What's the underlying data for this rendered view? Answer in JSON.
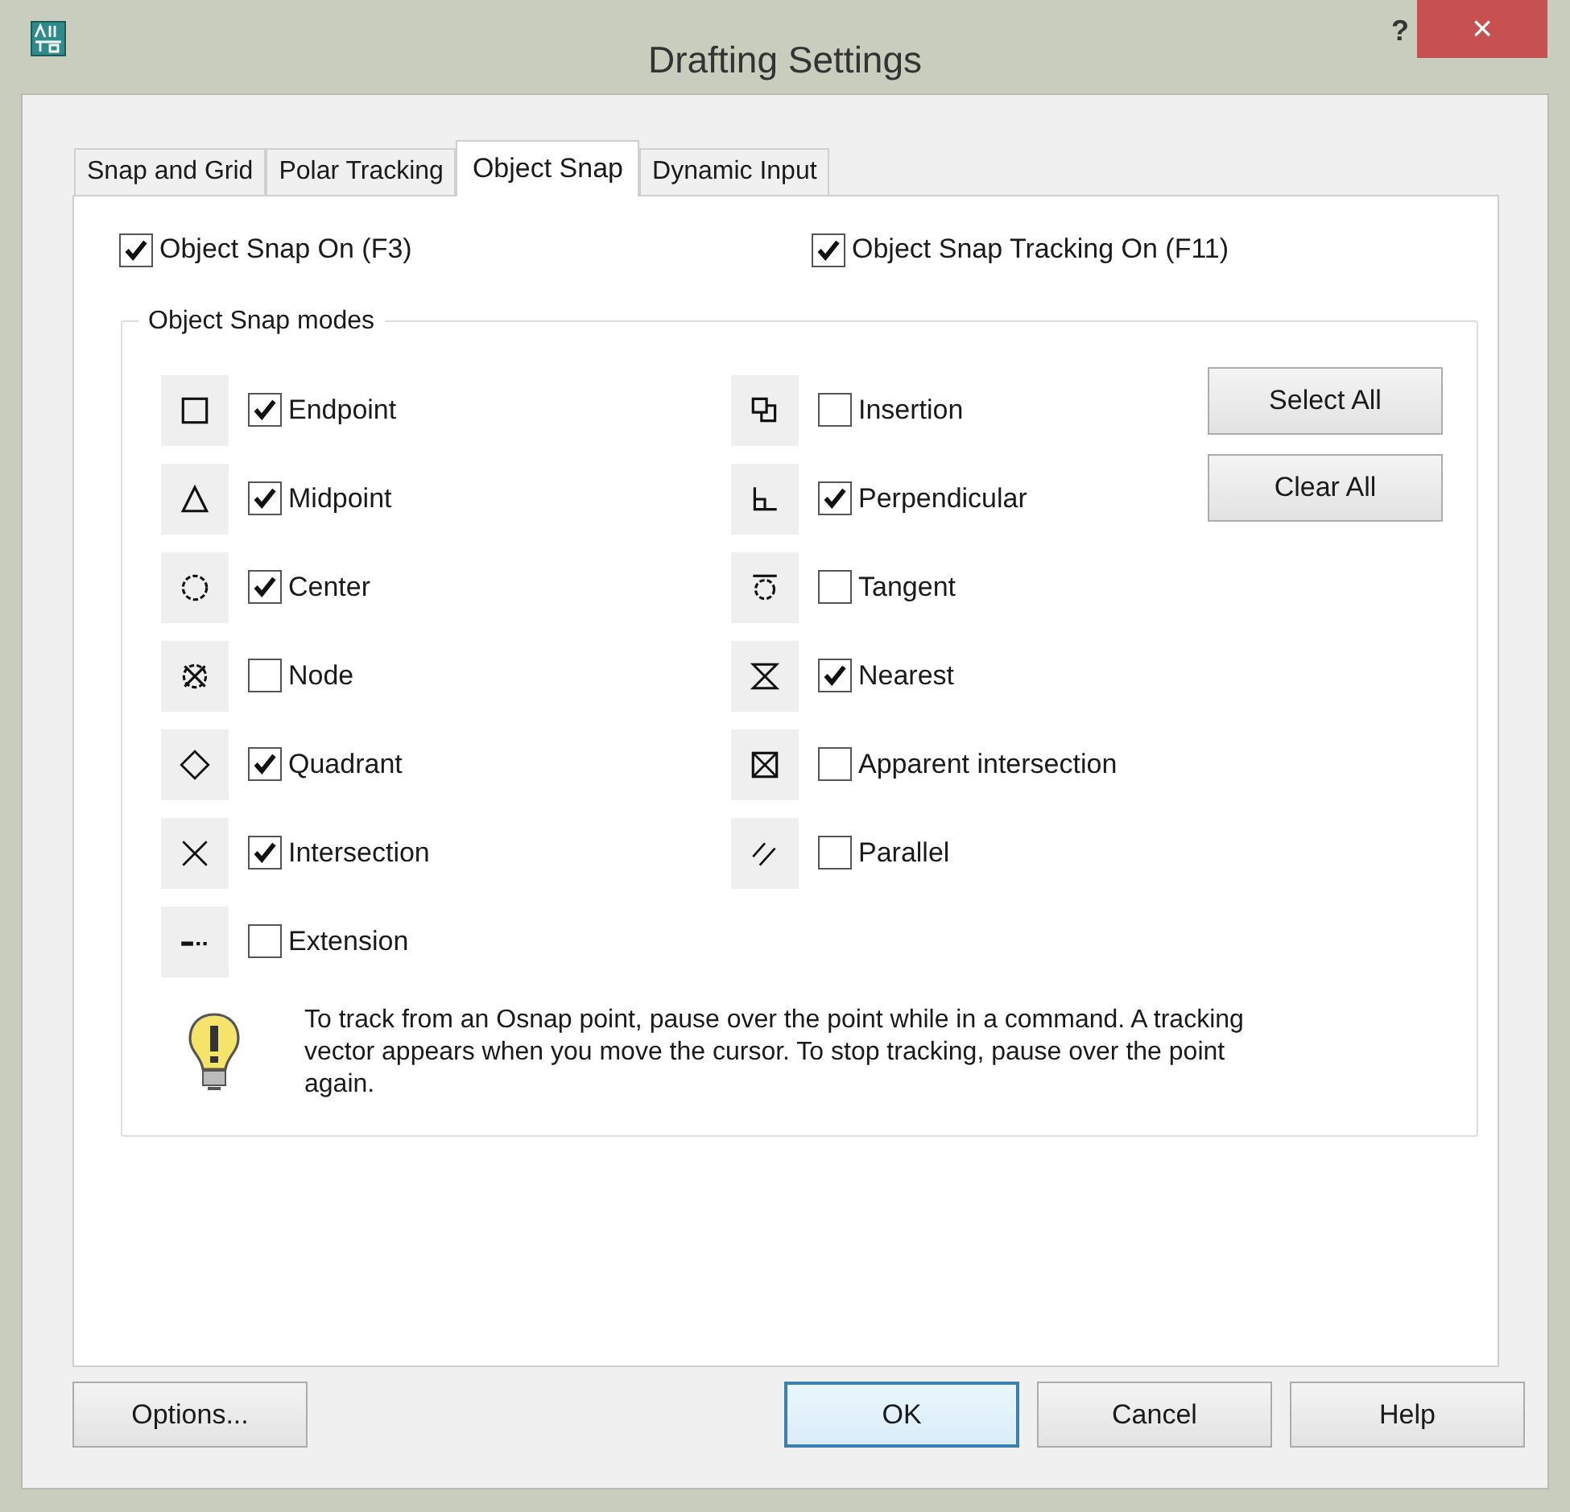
{
  "window": {
    "title": "Drafting Settings",
    "help": "?",
    "close": "×"
  },
  "tabs": [
    {
      "label": "Snap and Grid",
      "selected": false
    },
    {
      "label": "Polar Tracking",
      "selected": false
    },
    {
      "label": "Object Snap",
      "selected": true
    },
    {
      "label": "Dynamic Input",
      "selected": false
    }
  ],
  "toggles": [
    {
      "label": "Object Snap On (F3)",
      "checked": true
    },
    {
      "label": "Object Snap Tracking On (F11)",
      "checked": true
    }
  ],
  "modes_group": {
    "title": "Object Snap modes",
    "left": [
      {
        "label": "Endpoint",
        "checked": true
      },
      {
        "label": "Midpoint",
        "checked": true
      },
      {
        "label": "Center",
        "checked": true
      },
      {
        "label": "Node",
        "checked": false
      },
      {
        "label": "Quadrant",
        "checked": true
      },
      {
        "label": "Intersection",
        "checked": true
      },
      {
        "label": "Extension",
        "checked": false
      }
    ],
    "right": [
      {
        "label": "Insertion",
        "checked": false
      },
      {
        "label": "Perpendicular",
        "checked": true
      },
      {
        "label": "Tangent",
        "checked": false
      },
      {
        "label": "Nearest",
        "checked": true
      },
      {
        "label": "Apparent intersection",
        "checked": false
      },
      {
        "label": "Parallel",
        "checked": false
      }
    ],
    "buttons": [
      "Select All",
      "Clear All"
    ],
    "tip": "To track from an Osnap point, pause over the point while in a command.  A tracking vector appears when you move the cursor. To stop tracking, pause over the point again."
  },
  "footer_buttons": [
    {
      "label": "Options...",
      "kind": "normal"
    },
    {
      "label": "OK",
      "kind": "default"
    },
    {
      "label": "Cancel",
      "kind": "normal"
    },
    {
      "label": "Help",
      "kind": "normal"
    }
  ]
}
